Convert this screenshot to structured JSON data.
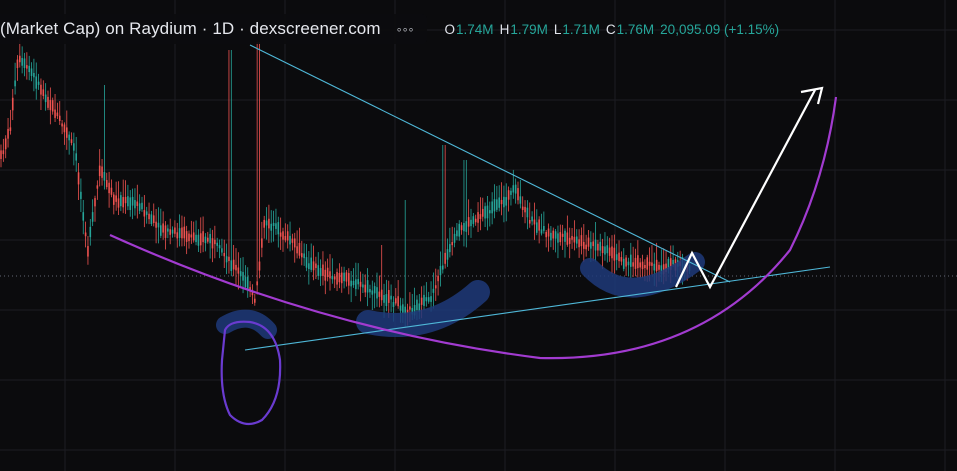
{
  "header": {
    "title": "(Market Cap) on Raydium · 1D · dexscreener.com",
    "more_label": "◦◦◦",
    "ohlc": {
      "o_key": "O",
      "o_val": "1.74M",
      "h_key": "H",
      "h_val": "1.79M",
      "l_key": "L",
      "l_val": "1.71M",
      "c_key": "C",
      "c_val": "1.76M",
      "change": "20,095.09 (+1.15%)"
    }
  },
  "colors": {
    "background": "#0b0b0d",
    "grid": "#1c1c22",
    "candle_up": "#26a69a",
    "candle_down": "#ef5350",
    "trendline": "#4fb8d8",
    "cup_curve": "#a23bd0",
    "circle_annotation": "#6a3bd0",
    "highlight_blob": "#1f3a7a",
    "arrow": "#ffffff",
    "price_line": "#7a7f8c"
  },
  "annotations": {
    "icons": [
      "arrow-up-icon"
    ]
  }
}
